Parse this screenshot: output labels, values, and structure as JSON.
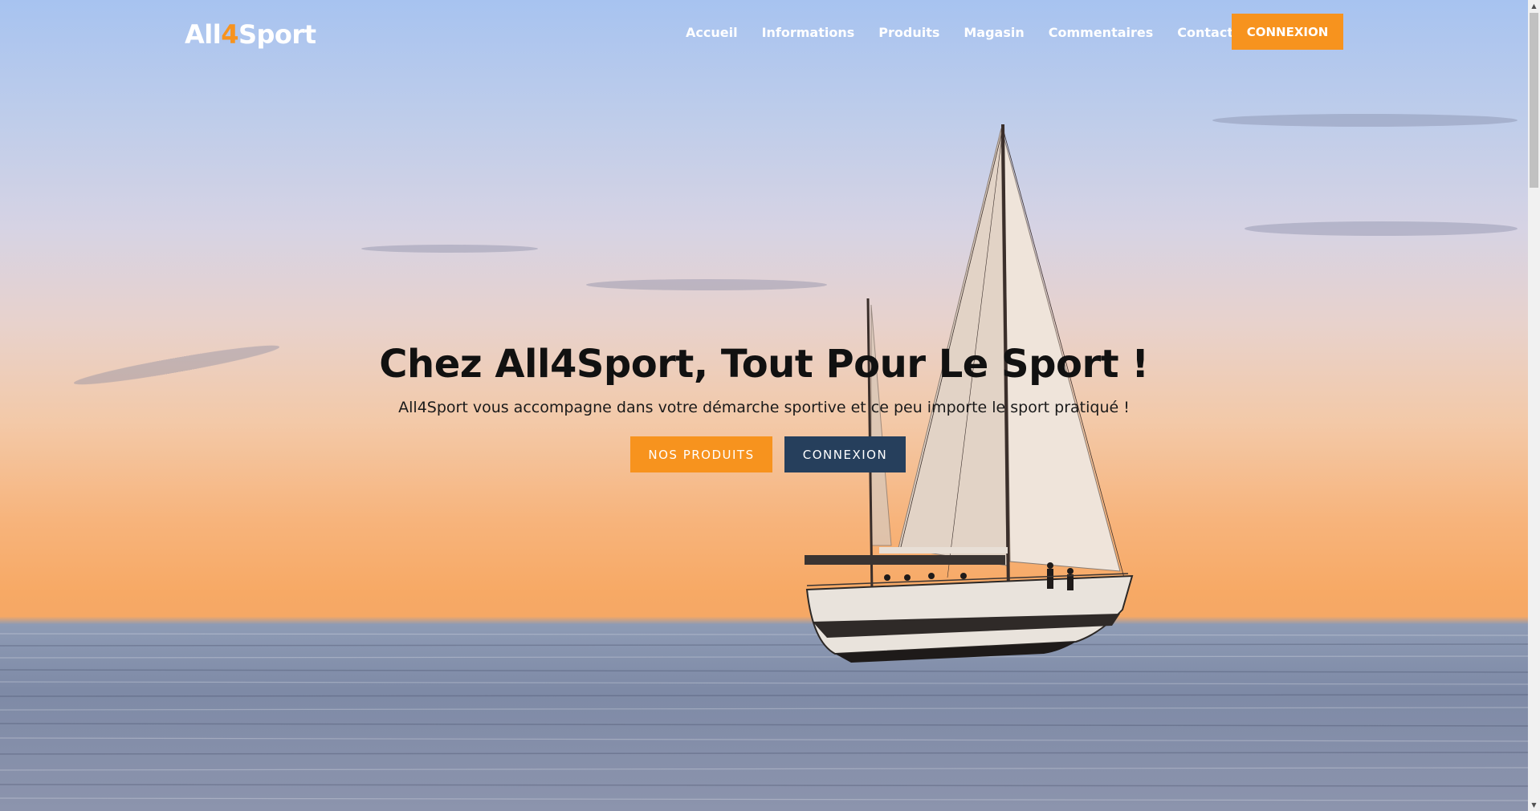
{
  "header": {
    "logo": {
      "part1": "All",
      "part2": "4",
      "part3": "Sport"
    },
    "nav": [
      {
        "label": "Accueil"
      },
      {
        "label": "Informations"
      },
      {
        "label": "Produits"
      },
      {
        "label": "Magasin"
      },
      {
        "label": "Commentaires"
      },
      {
        "label": "Contact"
      }
    ],
    "login_button": "CONNEXION"
  },
  "hero": {
    "title": "Chez All4Sport, Tout Pour Le Sport !",
    "subtitle": "All4Sport vous accompagne dans votre démarche sportive et ce peu importe le sport pratiqué !",
    "primary_button": "NOS PRODUITS",
    "secondary_button": "CONNEXION",
    "background_image": "sailboat-at-sunset"
  },
  "colors": {
    "accent": "#f7931e",
    "dark_button": "#263f5c",
    "text_dark": "#111111",
    "nav_text": "#ffffff"
  },
  "icons": {
    "scroll_up": "triangle-up-icon",
    "scroll_down": "triangle-down-icon"
  }
}
